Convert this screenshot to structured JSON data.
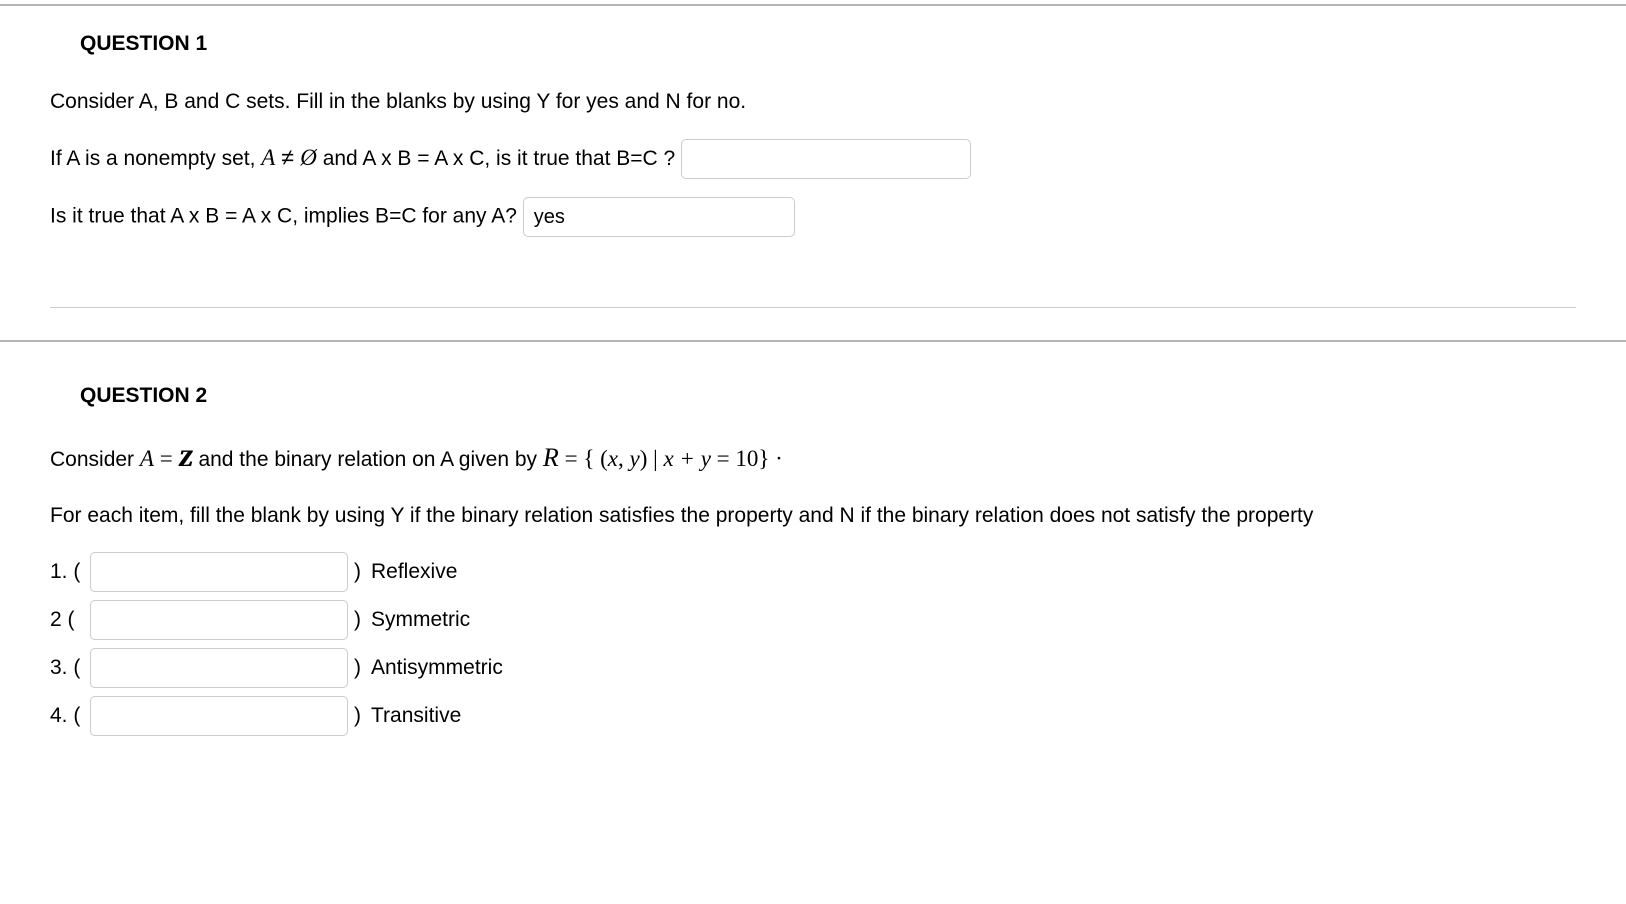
{
  "q1": {
    "heading": "QUESTION 1",
    "intro": "Consider A, B and C sets.  Fill in the blanks by using  Y for yes and N for no.",
    "line1_pre": "If A is a nonempty set, ",
    "math_A": "A",
    "neq": " ≠ ",
    "empty": "Ø",
    "line1_mid": "  and A x B = A x C, is it true that B=C ?",
    "input1_value": "",
    "line2_text": "Is it true that A x B = A x C, implies B=C for any A?",
    "input2_value": "yes"
  },
  "q2": {
    "heading": "QUESTION 2",
    "intro_pre": "Consider ",
    "math_A": "A",
    "eq": " = ",
    "Z": "Z",
    "intro_mid": " and the binary relation on A given by  ",
    "R": "R",
    "rel_eq": " = { (",
    "x": "x",
    "comma": ", ",
    "y": "y",
    "rel_mid": ") | ",
    "xplus": "x + y",
    "rel_end": " = 10} ·",
    "instructions": "For each item, fill the blank by using Y if the binary relation satisfies the property and N if the binary relation does not satisfy the property",
    "items": [
      {
        "num": "1. (",
        "close": ") ",
        "label": "Reflexive",
        "value": ""
      },
      {
        "num": "2 (",
        "close": ") ",
        "label": "Symmetric",
        "value": ""
      },
      {
        "num": "3. (",
        "close": ") ",
        "label": "Antisymmetric",
        "value": ""
      },
      {
        "num": "4. (",
        "close": ") ",
        "label": "Transitive",
        "value": ""
      }
    ]
  }
}
